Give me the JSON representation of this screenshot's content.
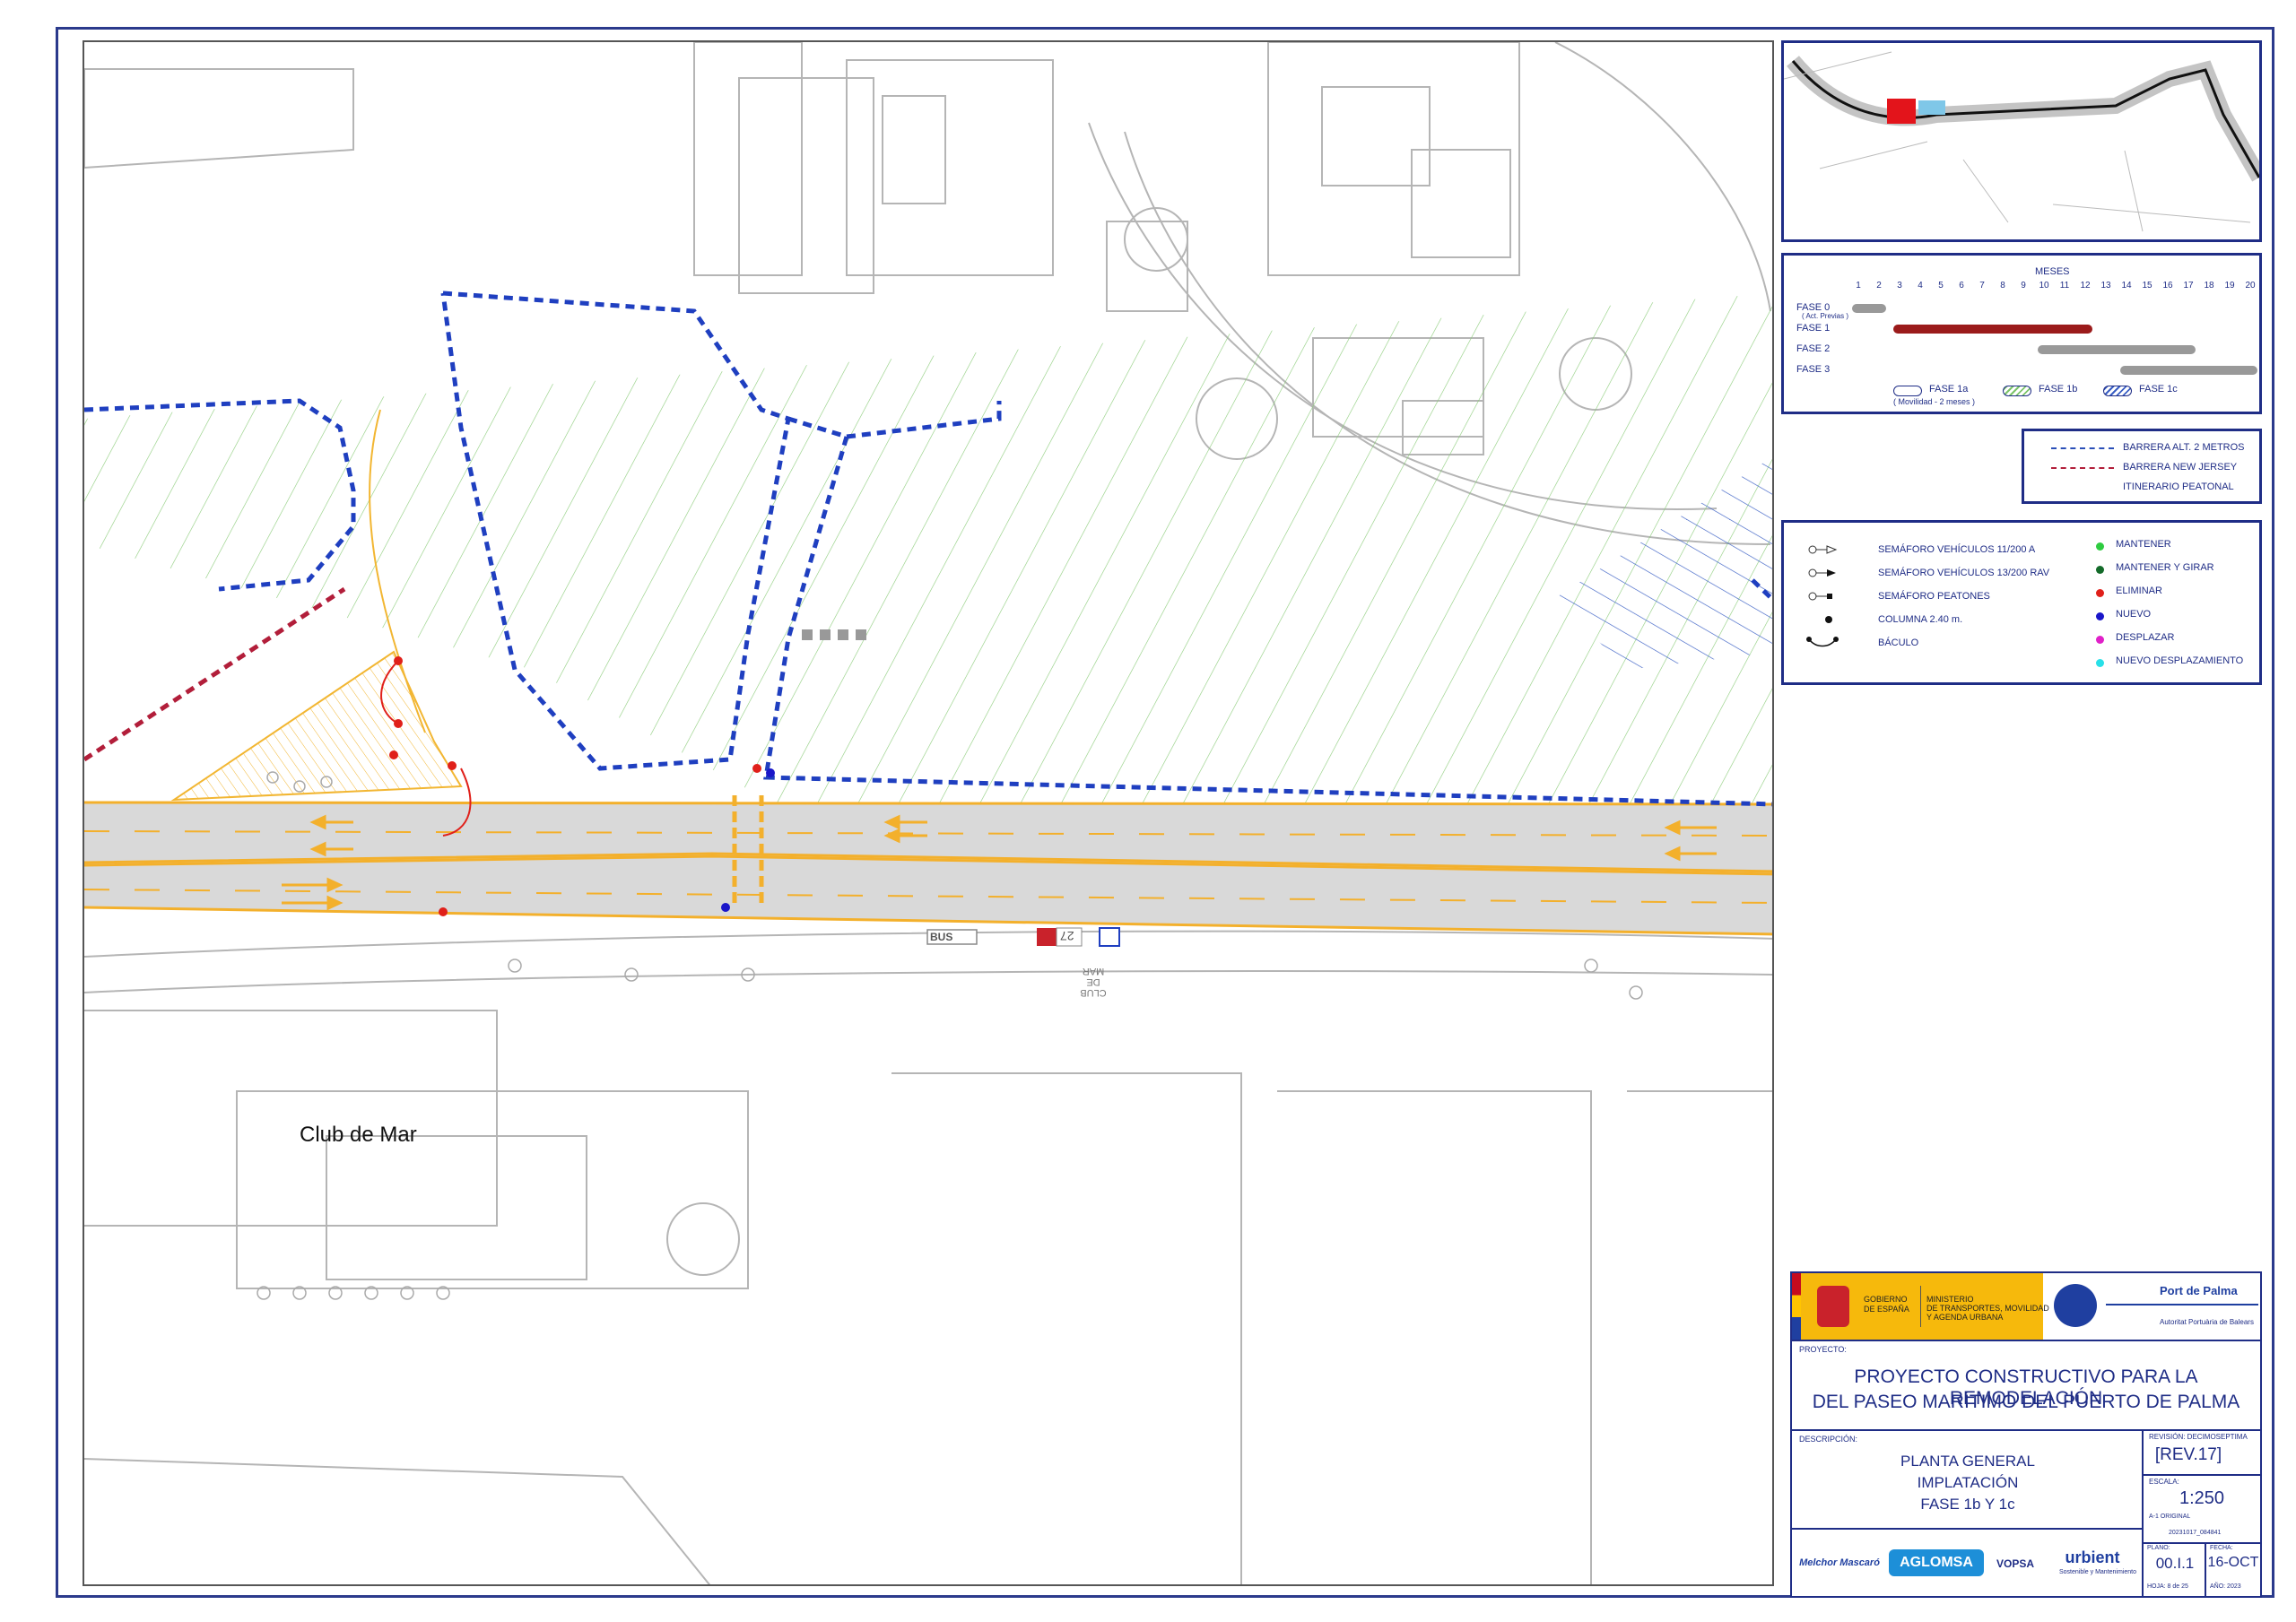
{
  "map": {
    "labels": {
      "club_de_mar": "Club de Mar",
      "bus": "BUS",
      "bus_line": "27",
      "road_text": "CLUB DE MAR"
    }
  },
  "schedule": {
    "header": "MESES",
    "months": [
      "1",
      "2",
      "3",
      "4",
      "5",
      "6",
      "7",
      "8",
      "9",
      "10",
      "11",
      "12",
      "13",
      "14",
      "15",
      "16",
      "17",
      "18",
      "19",
      "20"
    ],
    "phases": [
      {
        "label": "FASE 0",
        "sublabel": "( Act. Previas )",
        "start": 1,
        "end": 2,
        "color": "#999999"
      },
      {
        "label": "FASE 1",
        "sublabel": "",
        "start": 3,
        "end": 12,
        "color": "#9b1b1b"
      },
      {
        "label": "FASE 2",
        "sublabel": "",
        "start": 10,
        "end": 17,
        "color": "#999999"
      },
      {
        "label": "FASE 3",
        "sublabel": "",
        "start": 14,
        "end": 20,
        "color": "#999999"
      }
    ],
    "subphases": [
      {
        "label": "FASE 1a",
        "sublabel": "( Movilidad - 2 meses )"
      },
      {
        "label": "FASE 1b",
        "sublabel": ""
      },
      {
        "label": "FASE 1c",
        "sublabel": ""
      }
    ]
  },
  "barrier_legend": {
    "items": [
      {
        "label": "BARRERA ALT. 2 METROS",
        "color": "#2b4fb8"
      },
      {
        "label": "BARRERA NEW JERSEY",
        "color": "#b21e3a"
      },
      {
        "label": "ITINERARIO  PEATONAL",
        "color": ""
      }
    ]
  },
  "signal_legend": {
    "left": [
      {
        "label": "SEMÁFORO VEHÍCULOS 11/200 A"
      },
      {
        "label": "SEMÁFORO VEHÍCULOS 13/200 RAV"
      },
      {
        "label": "SEMÁFORO PEATONES"
      },
      {
        "label": "COLUMNA 2.40 m."
      },
      {
        "label": "BÁCULO"
      }
    ],
    "right": [
      {
        "label": "MANTENER",
        "color": "#2ecc40"
      },
      {
        "label": "MANTENER Y GIRAR",
        "color": "#146b2a"
      },
      {
        "label": "ELIMINAR",
        "color": "#e0201a"
      },
      {
        "label": "NUEVO",
        "color": "#1a16c9"
      },
      {
        "label": "DESPLAZAR",
        "color": "#e020c8"
      },
      {
        "label": "NUEVO DESPLAZAMIENTO",
        "color": "#28e0e8"
      }
    ]
  },
  "title_block": {
    "gov_1": "GOBIERNO",
    "gov_2": "DE ESPAÑA",
    "ministry_1": "MINISTERIO",
    "ministry_2": "DE TRANSPORTES, MOVILIDAD",
    "ministry_3": "Y AGENDA URBANA",
    "port_name": "Port de Palma",
    "port_sub": "Autoritat Portuària de Balears",
    "project_label": "PROYECTO:",
    "project_title_1": "PROYECTO CONSTRUCTIVO PARA LA REMODELACIÓN",
    "project_title_2": "DEL PASEO MARÍTIMO DEL PUERTO DE PALMA",
    "description_label": "DESCRIPCIÓN:",
    "description_1": "PLANTA GENERAL",
    "description_2": "IMPLATACIÓN",
    "description_3": "FASE 1b Y 1c",
    "revision_label": "REVISIÓN: DECIMOSEPTIMA",
    "revision": "[REV.17]",
    "scale_label": "ESCALA:",
    "scale": "1:250",
    "scale_note": "A-1 ORIGINAL",
    "file_code": "20231017_084841",
    "plano_label": "PLANO:",
    "plano": "00.I.1",
    "hoja": "HOJA: 8 de 25",
    "fecha_label": "FECHA:",
    "fecha": "16-OCT",
    "year": "AÑO: 2023",
    "logo_1": "Melchor Mascaró",
    "logo_2": "AGLOMSA",
    "logo_3": "VOPSA",
    "logo_4": "urbient",
    "logo_4_sub": "Sostenible y Mantenimiento"
  }
}
